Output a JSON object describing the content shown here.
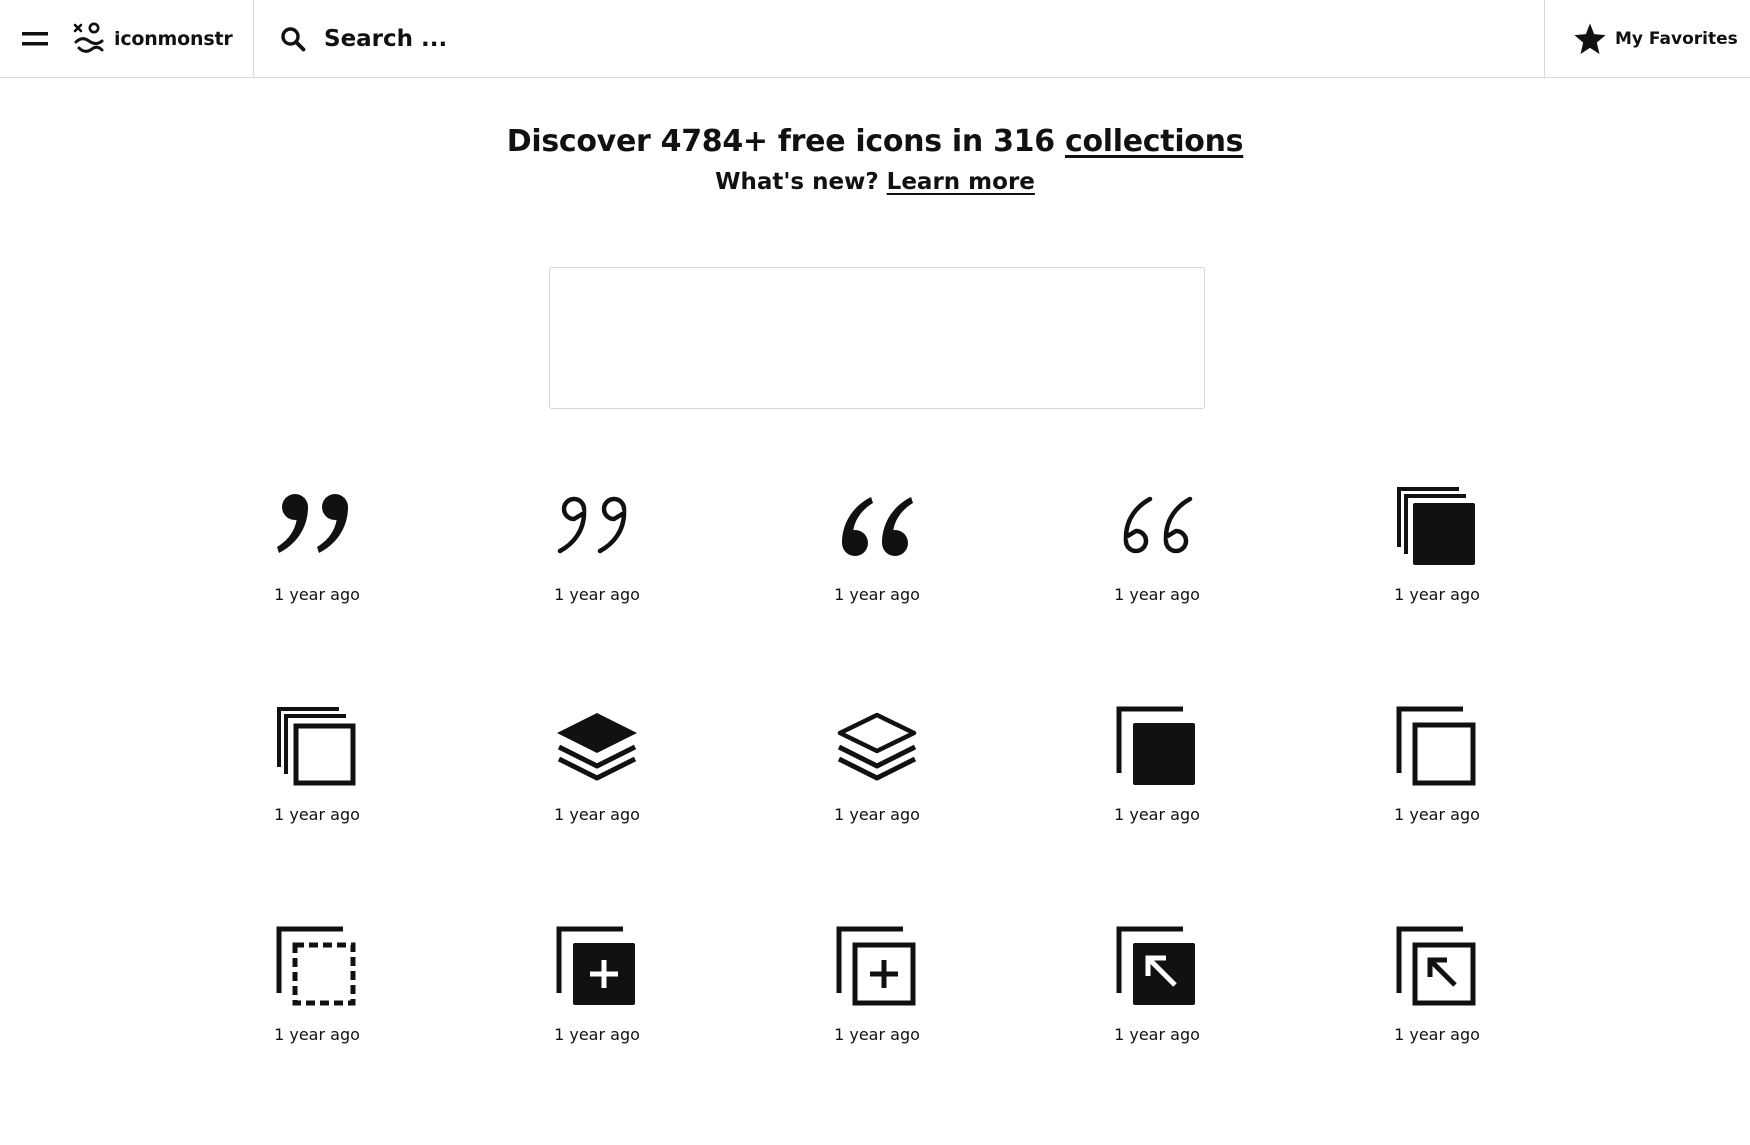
{
  "header": {
    "brand": "iconmonstr",
    "search_placeholder": "Search ...",
    "favorites_label": "My Favorites"
  },
  "hero": {
    "prefix": "Discover 4784+ free icons in 316 ",
    "collections_link": "collections",
    "whats_new": "What's new? ",
    "learn_more": "Learn more"
  },
  "icons": [
    {
      "name": "quote-close-filled-icon",
      "time": "1 year ago"
    },
    {
      "name": "quote-close-outline-icon",
      "time": "1 year ago"
    },
    {
      "name": "quote-open-filled-icon",
      "time": "1 year ago"
    },
    {
      "name": "quote-open-outline-icon",
      "time": "1 year ago"
    },
    {
      "name": "stack-filled-icon",
      "time": "1 year ago"
    },
    {
      "name": "stack-outline-icon",
      "time": "1 year ago"
    },
    {
      "name": "layers-filled-icon",
      "time": "1 year ago"
    },
    {
      "name": "layers-outline-icon",
      "time": "1 year ago"
    },
    {
      "name": "copy-filled-icon",
      "time": "1 year ago"
    },
    {
      "name": "copy-outline-icon",
      "time": "1 year ago"
    },
    {
      "name": "copy-dashed-icon",
      "time": "1 year ago"
    },
    {
      "name": "copy-add-filled-icon",
      "time": "1 year ago"
    },
    {
      "name": "copy-add-outline-icon",
      "time": "1 year ago"
    },
    {
      "name": "copy-arrow-filled-icon",
      "time": "1 year ago"
    },
    {
      "name": "copy-arrow-outline-icon",
      "time": "1 year ago"
    }
  ]
}
